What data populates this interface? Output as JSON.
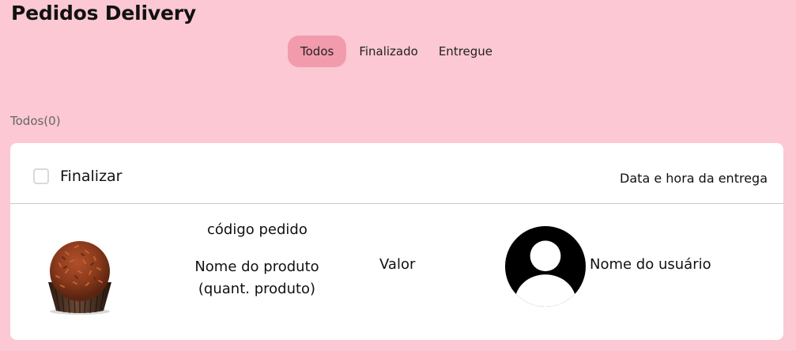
{
  "header": {
    "title": "Pedidos Delivery"
  },
  "tabs": [
    {
      "label": "Todos",
      "active": true
    },
    {
      "label": "Finalizado",
      "active": false
    },
    {
      "label": "Entregue",
      "active": false
    }
  ],
  "section": {
    "count_label": "Todos(0)"
  },
  "card": {
    "finalize_label": "Finalizar",
    "finalize_checked": false,
    "delivery_datetime_label": "Data e hora da entrega",
    "order": {
      "code_label": "código pedido",
      "product_name_label": "Nome do produto",
      "product_quantity_label": "(quant. produto)",
      "value_label": "Valor",
      "username_label": "Nome do usuário",
      "product_icon": "brigadeiro-image",
      "avatar_icon": "user-avatar-icon"
    }
  },
  "colors": {
    "background": "#fbc8d3",
    "active_tab": "#f29bac",
    "card": "#ffffff"
  }
}
